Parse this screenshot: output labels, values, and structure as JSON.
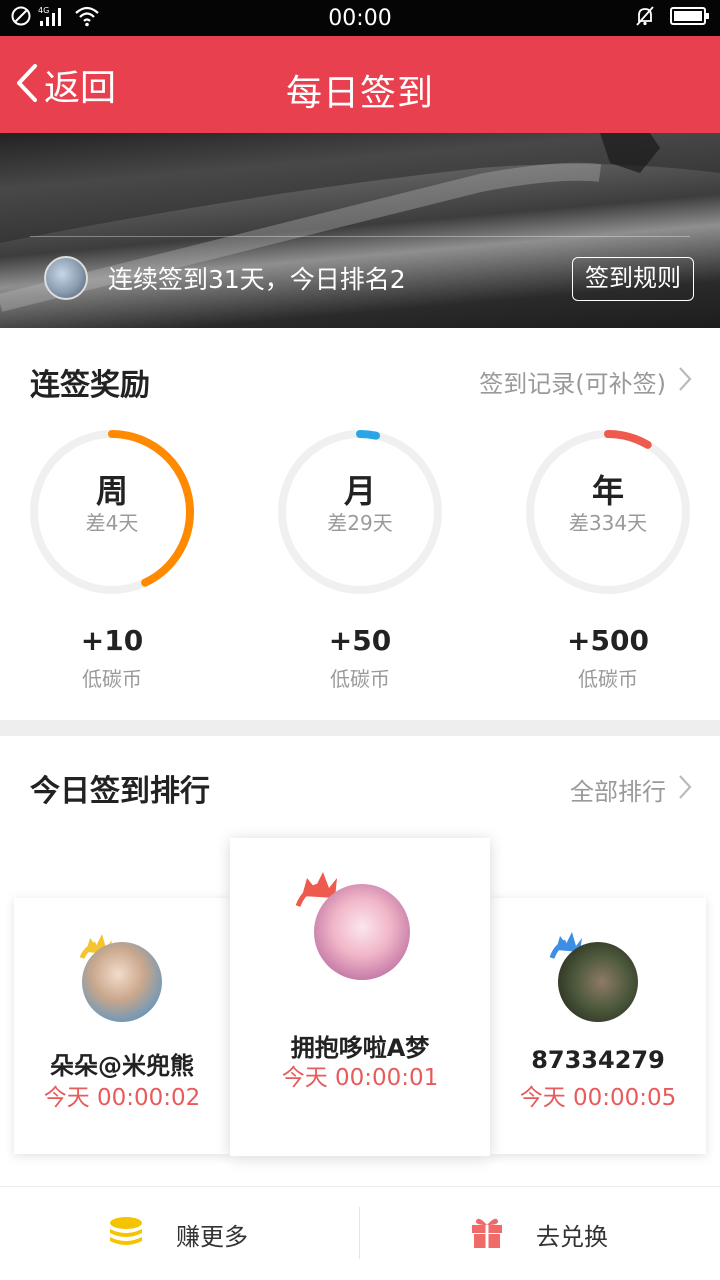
{
  "status_bar": {
    "time": "00:00",
    "network": "4G"
  },
  "header": {
    "back_label": "返回",
    "title": "每日签到"
  },
  "banner": {
    "streak_text": "连续签到31天，今日排名2",
    "rules_button": "签到规则"
  },
  "rewards": {
    "title": "连签奖励",
    "record_link": "签到记录(可补签)",
    "items": [
      {
        "period": "周",
        "remaining": "差4天",
        "amount": "+10",
        "unit": "低碳币",
        "progress": 0.43,
        "color": "#ff8a00"
      },
      {
        "period": "月",
        "remaining": "差29天",
        "amount": "+50",
        "unit": "低碳币",
        "progress": 0.033,
        "color": "#2aa6e8"
      },
      {
        "period": "年",
        "remaining": "差334天",
        "amount": "+500",
        "unit": "低碳币",
        "progress": 0.085,
        "color": "#ef5a4f"
      }
    ]
  },
  "ranking": {
    "title": "今日签到排行",
    "all_link": "全部排行",
    "entries": [
      {
        "rank": 2,
        "name": "朵朵@米兜熊",
        "time": "今天 00:00:02",
        "crown_color": "#f4c531"
      },
      {
        "rank": 1,
        "name": "拥抱哆啦A梦",
        "time": "今天 00:00:01",
        "crown_color": "#ef5a4f"
      },
      {
        "rank": 3,
        "name": "87334279",
        "time": "今天 00:00:05",
        "crown_color": "#3d8fe6"
      }
    ]
  },
  "bottom_bar": {
    "earn_label": "赚更多",
    "exchange_label": "去兑换"
  },
  "colors": {
    "accent": "#e8404f",
    "time_text": "#e85b5b",
    "coin": "#f5c400",
    "gift": "#f06a6a"
  }
}
